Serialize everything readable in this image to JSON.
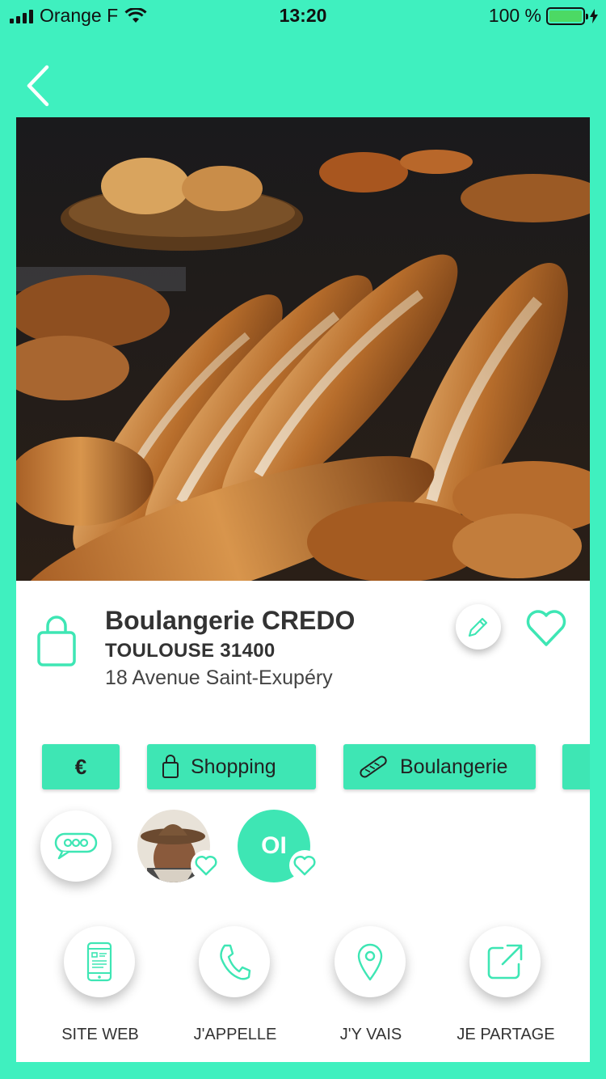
{
  "status": {
    "carrier": "Orange F",
    "time": "13:20",
    "battery": "100 %",
    "battery_level": 1.0
  },
  "place": {
    "name": "Boulangerie CREDO",
    "city": "TOULOUSE 31400",
    "address": "18 Avenue Saint-Exupéry"
  },
  "tags": {
    "price": "€",
    "category": "Shopping",
    "subcategory": "Boulangerie"
  },
  "social": {
    "user_initials": "OI"
  },
  "actions": [
    {
      "label": "SITE WEB",
      "icon": "smartphone-icon"
    },
    {
      "label": "J'APPELLE",
      "icon": "phone-icon"
    },
    {
      "label": "J'Y VAIS",
      "icon": "location-pin-icon"
    },
    {
      "label": "JE PARTAGE",
      "icon": "share-icon"
    }
  ],
  "colors": {
    "accent": "#3ee6b4",
    "background": "#3ff0bf"
  }
}
